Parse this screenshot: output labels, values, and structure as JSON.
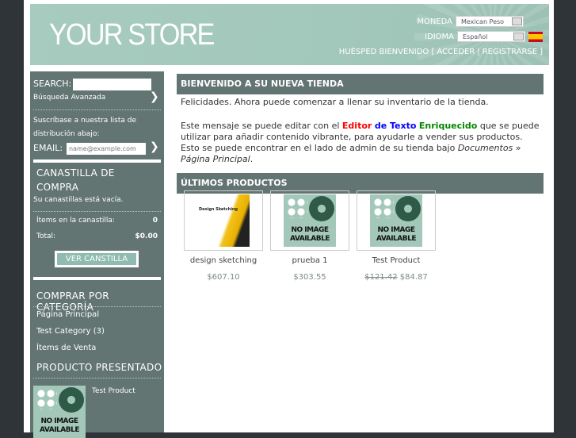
{
  "header": {
    "logo": "YOUR STORE",
    "currency_label": "MONEDA",
    "currency_value": "Mexican Peso",
    "language_label": "IDIOMA",
    "language_value": "Español",
    "welcome": "HUÉSPED BIENVENIDO [",
    "login": "ACCEDER",
    "sep": "|",
    "register": "REGISTRARSE",
    "close": "]"
  },
  "sidebar": {
    "search_label": "SEARCH:",
    "advanced_search": "Búsqueda Avanzada",
    "newsletter_line1": "Suscríbase a nuestra lista de",
    "newsletter_line2": "distribución abajo:",
    "email_label": "EMAIL:",
    "email_placeholder": "name@example.com",
    "cart_title_1": "CANASTILLA DE",
    "cart_title_2": "COMPRA",
    "cart_empty": "Su canastillas está vacía.",
    "items_label": "Ítems en la canastilla:",
    "items_value": "0",
    "total_label": "Total:",
    "total_value": "$0.00",
    "view_cart": "VER CANSTILLA",
    "categories_title": "COMPRAR POR CATEGORÍA",
    "categories": [
      "Página Principal",
      "Test Category (3)",
      "Ítems de Venta"
    ],
    "featured_title": "PRODUCTO PRESENTADO",
    "featured_name": "Test Product",
    "featured_noimage": "NO IMAGE AVAILABLE"
  },
  "main": {
    "welcome_title": "BIENVENIDO A SU NUEVA TIENDA",
    "p1": "Felicidades. Ahora puede comenzar a llenar su inventario de la tienda.",
    "p2_a": "Este mensaje se puede editar con el ",
    "p2_red": "Editor",
    "p2_blue": "de Texto",
    "p2_green": "Enriquecido",
    "p2_b": " que se puede utilizar para añadir contenido vibrante, para ayudarle a vender sus productos. Esto se puede encontrar en el lado de admin de su tienda bajo ",
    "p2_doc": "Documentos",
    "p2_raquo": " » ",
    "p2_page": "Página Principal",
    "p2_end": ".",
    "latest_title": "ÚLTIMOS PRODUCTOS",
    "products": [
      {
        "name": "design sketching",
        "price": "$607.10",
        "cover": "Design Sketching"
      },
      {
        "name": "prueba 1",
        "price": "$303.55",
        "noimage": "NO IMAGE AVAILABLE"
      },
      {
        "name": "Test Product",
        "old_price": "$121.42",
        "price": "$84.87",
        "noimage": "NO IMAGE AVAILABLE"
      }
    ]
  },
  "colors": {
    "sidebar": "#637572",
    "header": "#a7cbbf",
    "red": "#ff0000",
    "blue": "#0000ff",
    "green": "#008000"
  }
}
